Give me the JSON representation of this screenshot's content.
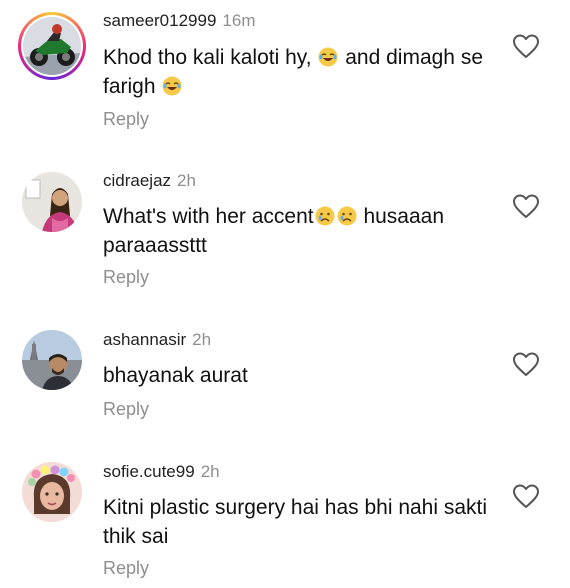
{
  "comments": [
    {
      "username": "sameer012999",
      "time": "16m",
      "text_part1": "Khod tho kali kaloti hy, ",
      "text_part2": " and dimagh se farigh ",
      "emoji_1": "laughing-crying-emoji",
      "emoji_2": "laughing-crying-emoji",
      "reply": "Reply"
    },
    {
      "username": "cidraejaz",
      "time": "2h",
      "text_part1": "What's with her accent",
      "text_part2": " husaaan paraaassttt",
      "emoji_1": "crying-face-emoji",
      "emoji_2": "crying-face-emoji",
      "reply": "Reply"
    },
    {
      "username": "ashannasir",
      "time": "2h",
      "text": "bhayanak aurat",
      "reply": "Reply"
    },
    {
      "username": "sofie.cute99",
      "time": "2h",
      "text": "Kitni plastic surgery hai has bhi nahi sakti thik sai",
      "reply": "Reply"
    }
  ],
  "icons": {
    "like": "heart-outline-icon"
  },
  "colors": {
    "secondary_text": "#8e8e8e",
    "primary_text": "#111111",
    "story_ring": "#ee2a7b"
  }
}
